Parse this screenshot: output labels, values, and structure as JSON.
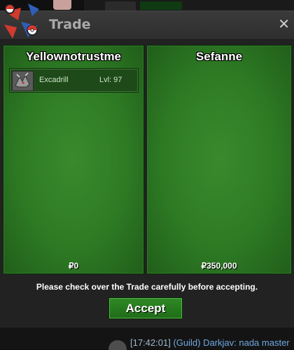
{
  "window": {
    "title": "Trade",
    "close_glyph": "✕"
  },
  "left_trader": {
    "name": "Yellownotrustme",
    "items": [
      {
        "name": "Excadrill",
        "level": "Lvl: 97",
        "icon": "excadrill-sprite-icon"
      }
    ],
    "money": "₽0"
  },
  "right_trader": {
    "name": "Sefanne",
    "items": [],
    "money": "₽350,000"
  },
  "notice": "Please check over the Trade carefully before accepting.",
  "accept_label": "Accept",
  "chat": {
    "time": "[17:42:01]",
    "text": "(Guild) Darkjav: nada master"
  },
  "colors": {
    "panel_green": "#2d7a24",
    "accept_green": "#2f8a24",
    "chat_blue": "#6fa8e0"
  }
}
